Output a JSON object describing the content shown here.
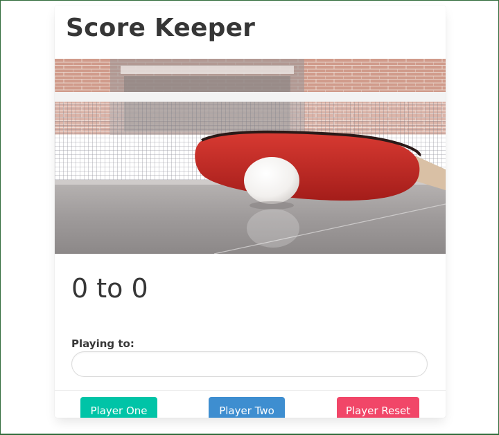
{
  "app": {
    "title": "Score Keeper"
  },
  "image": {
    "icon": "ping-pong-paddle-and-ball-photo"
  },
  "scoreboard": {
    "score_text": "0 to 0"
  },
  "settings": {
    "playing_to_label": "Playing to:",
    "playing_to_value": ""
  },
  "footer": {
    "player_one_label": "Player One",
    "player_two_label": "Player Two",
    "reset_label": "Player Reset"
  },
  "colors": {
    "player_one": "#00c4a7",
    "player_two": "#3e8ed0",
    "reset": "#f14668",
    "text": "#363636"
  }
}
